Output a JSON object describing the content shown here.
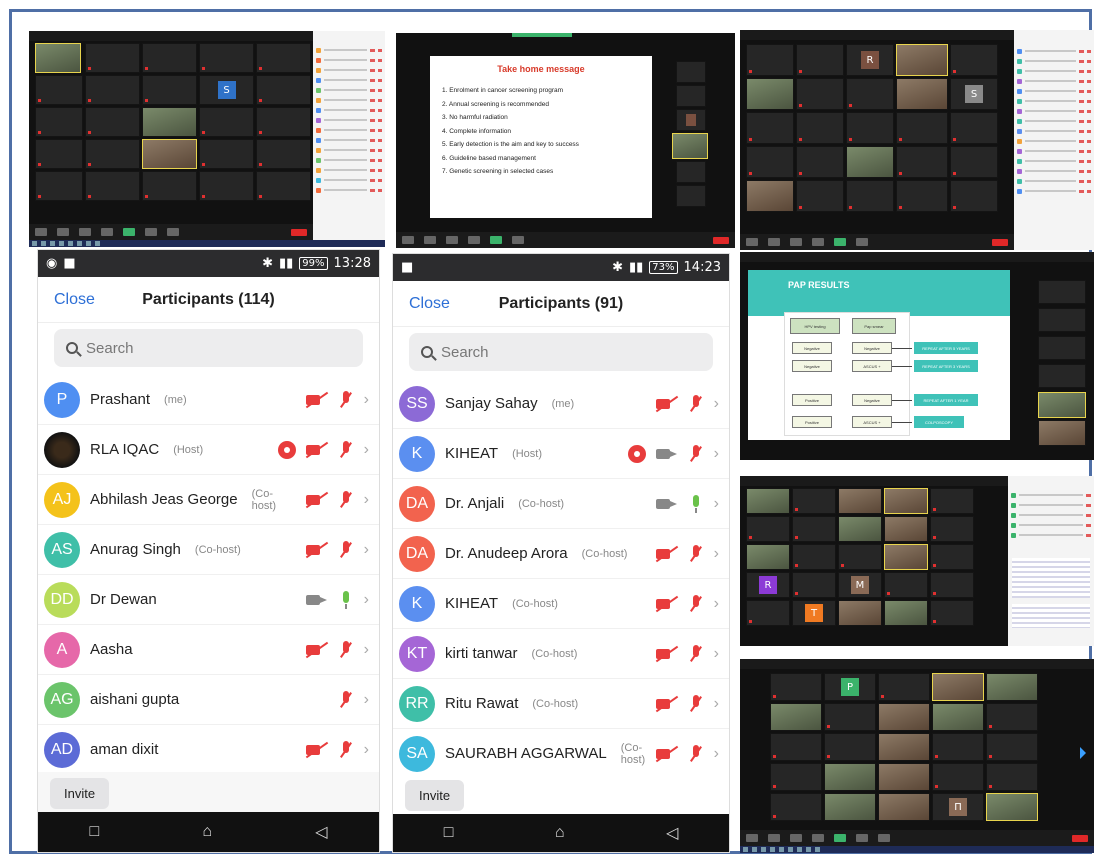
{
  "shot_slide1": {
    "title": "Take home message",
    "items": [
      "1. Enrolment in cancer screening program",
      "2. Annual screening is recommended",
      "3. No harmful radiation",
      "4. Complete information",
      "5. Early detection is the aim and key to success",
      "6. Guideline based management",
      "7. Genetic screening in selected cases"
    ]
  },
  "shot_pap": {
    "title": "PAP RESULTS",
    "boxes": {
      "hpv": "HPV testing",
      "pap": "Pap smear",
      "neg1": "Negative",
      "neg2": "Negative",
      "neg3": "Negative",
      "pos1": "Positive",
      "pos2": "Positive",
      "ascus1": "ASCUS +",
      "ascus2": "ASCUS +",
      "r5": "REPEAT AFTER 5 YEARS",
      "r3": "REPEAT AFTER 3 YEARS",
      "r1": "REPEAT AFTER 1 YEAR",
      "colpo": "COLPOSCOPY"
    }
  },
  "phone1": {
    "status_time": "13:28",
    "battery": "99%",
    "close": "Close",
    "title": "Participants (114)",
    "search_placeholder": "Search",
    "invite": "Invite",
    "participants": [
      {
        "initials": "P",
        "name": "Prashant",
        "role": "(me)",
        "color": "#4f8ff2",
        "video": "off",
        "mic": "off",
        "rec": false
      },
      {
        "initials": "",
        "name": "RLA IQAC",
        "role": "(Host)",
        "color": "#222222",
        "video": "off",
        "mic": "off",
        "rec": true
      },
      {
        "initials": "AJ",
        "name": "Abhilash Jeas George",
        "role": "(Co-host)",
        "color": "#f4c21a",
        "video": "off",
        "mic": "off",
        "rec": false
      },
      {
        "initials": "AS",
        "name": "Anurag Singh",
        "role": "(Co-host)",
        "color": "#3fbfa8",
        "video": "off",
        "mic": "off",
        "rec": false
      },
      {
        "initials": "DD",
        "name": "Dr Dewan",
        "role": "",
        "color": "#b9dc5a",
        "video": "on",
        "mic": "on",
        "rec": false
      },
      {
        "initials": "A",
        "name": "Aasha",
        "role": "",
        "color": "#e668a9",
        "video": "off",
        "mic": "off",
        "rec": false
      },
      {
        "initials": "AG",
        "name": "aishani gupta",
        "role": "",
        "color": "#6bc46b",
        "video": "none",
        "mic": "off",
        "rec": false
      },
      {
        "initials": "AD",
        "name": "aman dixit",
        "role": "",
        "color": "#5c6bd6",
        "video": "off",
        "mic": "off",
        "rec": false
      }
    ]
  },
  "phone2": {
    "status_time": "14:23",
    "battery": "73%",
    "close": "Close",
    "title": "Participants (91)",
    "search_placeholder": "Search",
    "invite": "Invite",
    "participants": [
      {
        "initials": "SS",
        "name": "Sanjay Sahay",
        "role": "(me)",
        "color": "#8c6ad6",
        "video": "off",
        "mic": "off",
        "rec": false
      },
      {
        "initials": "K",
        "name": "KIHEAT",
        "role": "(Host)",
        "color": "#5b8ff0",
        "video": "on",
        "mic": "off",
        "rec": true
      },
      {
        "initials": "DA",
        "name": "Dr. Anjali",
        "role": "(Co-host)",
        "color": "#f2634e",
        "video": "on",
        "mic": "on",
        "rec": false
      },
      {
        "initials": "DA",
        "name": "Dr. Anudeep Arora",
        "role": "(Co-host)",
        "color": "#f2634e",
        "video": "off",
        "mic": "off",
        "rec": false
      },
      {
        "initials": "K",
        "name": "KIHEAT",
        "role": "(Co-host)",
        "color": "#5b8ff0",
        "video": "off",
        "mic": "off",
        "rec": false
      },
      {
        "initials": "KT",
        "name": "kirti tanwar",
        "role": "(Co-host)",
        "color": "#a566d6",
        "video": "off",
        "mic": "off",
        "rec": false
      },
      {
        "initials": "RR",
        "name": "Ritu Rawat",
        "role": "(Co-host)",
        "color": "#3fbfa8",
        "video": "off",
        "mic": "off",
        "rec": false
      },
      {
        "initials": "SA",
        "name": "SAURABH AGGARWAL",
        "role": "(Co-host)",
        "color": "#3db9dd",
        "video": "off",
        "mic": "off",
        "rec": false
      }
    ]
  },
  "gallery_letters": {
    "g1_s": "S",
    "g2_r": "R",
    "g2_s": "S",
    "g3_r": "R",
    "g3_m": "M",
    "g3_t": "T",
    "g4_p": "P",
    "g4_n": "Π"
  },
  "nav": {
    "square": "□",
    "home": "⌂",
    "back": "◁"
  },
  "colors": {
    "frame": "#4f6fa6",
    "red": "#e83c3c",
    "blue": "#2d6fd6"
  }
}
